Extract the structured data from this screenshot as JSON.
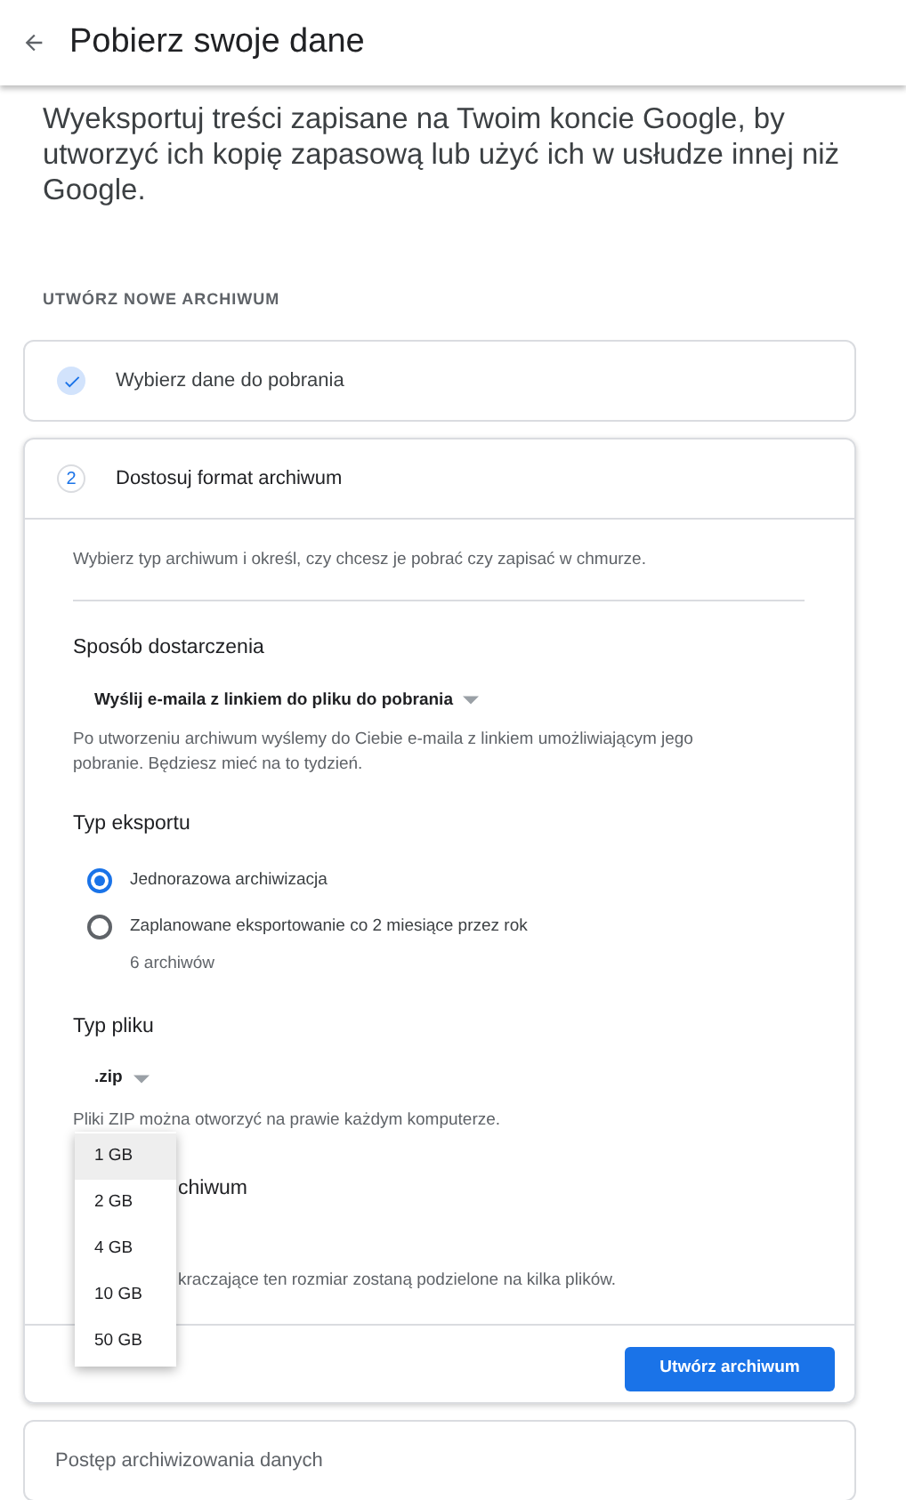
{
  "header": {
    "title": "Pobierz swoje dane"
  },
  "intro": "Wyeksportuj treści zapisane na Twoim koncie Google, by utworzyć ich kopię zapasową lub użyć ich w usłudze innej niż Google.",
  "section_label": "UTWÓRZ NOWE ARCHIWUM",
  "steps": [
    {
      "title": "Wybierz dane do pobrania",
      "completed": true
    },
    {
      "number": "2",
      "title": "Dostosuj format archiwum",
      "completed": false
    }
  ],
  "step_description": "Wybierz typ archiwum i określ, czy chcesz je pobrać czy zapisać w chmurze.",
  "delivery": {
    "heading": "Sposób dostarczenia",
    "value": "Wyślij e-maila z linkiem do pliku do pobrania",
    "note": "Po utworzeniu archiwum wyślemy do Ciebie e-maila z linkiem umożliwiającym jego pobranie. Będziesz mieć na to tydzień."
  },
  "export_type": {
    "heading": "Typ eksportu",
    "options": [
      {
        "label": "Jednorazowa archiwizacja",
        "selected": true
      },
      {
        "label": "Zaplanowane eksportowanie co 2 miesiące przez rok",
        "detail": "6 archiwów",
        "selected": false
      }
    ]
  },
  "file_type": {
    "heading": "Typ pliku",
    "value": ".zip",
    "note": "Pliki ZIP można otworzyć na prawie każdym komputerze."
  },
  "archive_size": {
    "heading": "chiwum",
    "note": "kraczające ten rozmiar zostaną podzielone na kilka plików."
  },
  "size_menu": [
    {
      "label": "1 GB",
      "selected": true
    },
    {
      "label": "2 GB",
      "selected": false
    },
    {
      "label": "4 GB",
      "selected": false
    },
    {
      "label": "10 GB",
      "selected": false
    },
    {
      "label": "50 GB",
      "selected": false
    }
  ],
  "create_button": "Utwórz archiwum",
  "progress_card": "Postęp archiwizowania danych"
}
